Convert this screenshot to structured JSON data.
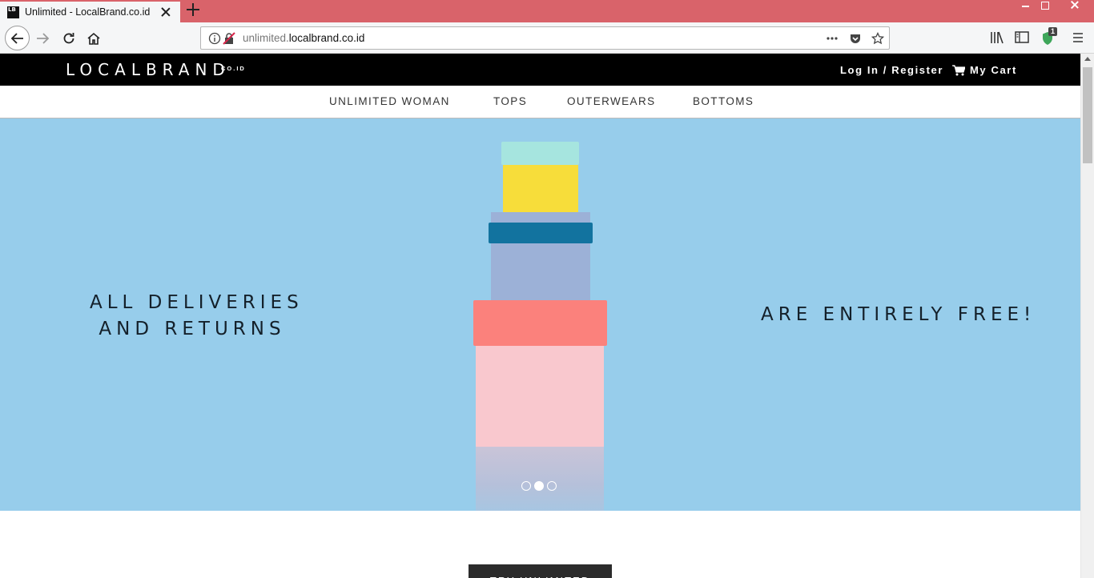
{
  "browser": {
    "tab": {
      "favicon_text": "LB",
      "title": "Unlimited - LocalBrand.co.id"
    },
    "url": {
      "domain_prefix": "unlimited.",
      "domain": "localbrand.co.id"
    },
    "extension_badge": "1"
  },
  "site": {
    "logo": "LOCALBRAND",
    "logo_suffix": "CO.ID",
    "login_label": "Log In / Register",
    "cart_label": "My Cart",
    "categories": [
      "UNLIMITED WOMAN",
      "TOPS",
      "OUTERWEARS",
      "BOTTOMS"
    ]
  },
  "hero": {
    "left_line1": "ALL DELIVERIES",
    "left_line2": "AND RETURNS",
    "right_text": "ARE ENTIRELY FREE!",
    "slide_count": 3,
    "active_slide": 2,
    "background_color": "#97cdeb"
  },
  "cta_label": "TRY UNLIMITED"
}
